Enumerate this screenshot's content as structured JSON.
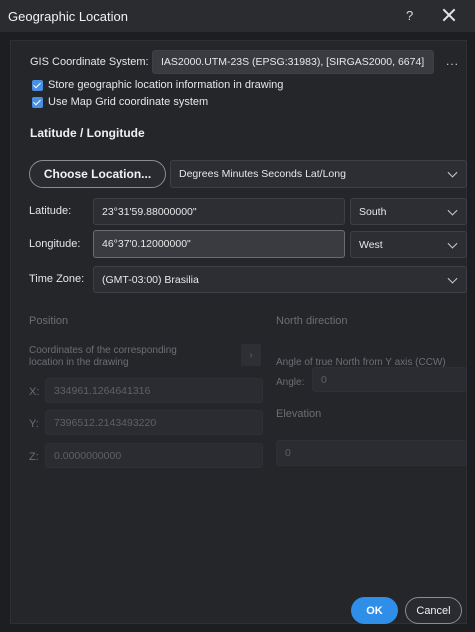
{
  "window": {
    "title": "Geographic Location",
    "help_glyph": "?"
  },
  "gis": {
    "label": "GIS Coordinate System:",
    "value": "IAS2000.UTM-23S (EPSG:31983), [SIRGAS2000, 6674]",
    "more_glyph": "..."
  },
  "checkboxes": {
    "store_label": "Store geographic location information in drawing",
    "mapgrid_label": "Use Map Grid coordinate system"
  },
  "latlong": {
    "section_title": "Latitude / Longitude",
    "choose_button": "Choose Location...",
    "format_value": "Degrees Minutes Seconds Lat/Long",
    "latitude_label": "Latitude:",
    "latitude_value": "23°31'59.88000000\"",
    "latitude_dir": "South",
    "longitude_label": "Longitude:",
    "longitude_value": "46°37'0.12000000\"",
    "longitude_dir": "West",
    "timezone_label": "Time Zone:",
    "timezone_value": "(GMT-03:00) Brasilia"
  },
  "position": {
    "title": "Position",
    "desc_line1": "Coordinates of the corresponding",
    "desc_line2": "location in the drawing",
    "x_label": "X:",
    "x_value": "334961.1264641316",
    "y_label": "Y:",
    "y_value": "7396512.2143493220",
    "z_label": "Z:",
    "z_value": "0.0000000000"
  },
  "north": {
    "title": "North direction",
    "desc": "Angle of true North from Y axis (CCW)",
    "angle_label": "Angle:",
    "angle_value": "0",
    "elevation_title": "Elevation",
    "elevation_value": "0"
  },
  "footer": {
    "ok_label": "OK",
    "cancel_label": "Cancel"
  },
  "colors": {
    "accent": "#2f8fe8",
    "background": "#25262a",
    "field": "#3a3b40"
  }
}
